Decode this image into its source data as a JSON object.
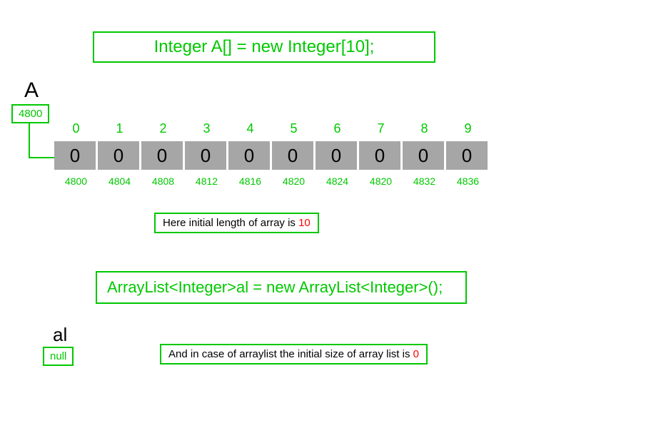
{
  "top_code": "Integer A[] = new Integer[10];",
  "label_A": "A",
  "ref_A": "4800",
  "indices": [
    "0",
    "1",
    "2",
    "3",
    "4",
    "5",
    "6",
    "7",
    "8",
    "9"
  ],
  "cells": [
    "0",
    "0",
    "0",
    "0",
    "0",
    "0",
    "0",
    "0",
    "0",
    "0"
  ],
  "addresses": [
    "4800",
    "4804",
    "4808",
    "4812",
    "4816",
    "4820",
    "4824",
    "4820",
    "4832",
    "4836"
  ],
  "note1_prefix": "Here initial length of array  is ",
  "note1_num": "10",
  "bottom_code": "ArrayList<Integer>al = new ArrayList<Integer>();",
  "label_al": "al",
  "ref_al": "null",
  "note2_prefix": "And in case of arraylist the initial size of array list is ",
  "note2_num": "0"
}
